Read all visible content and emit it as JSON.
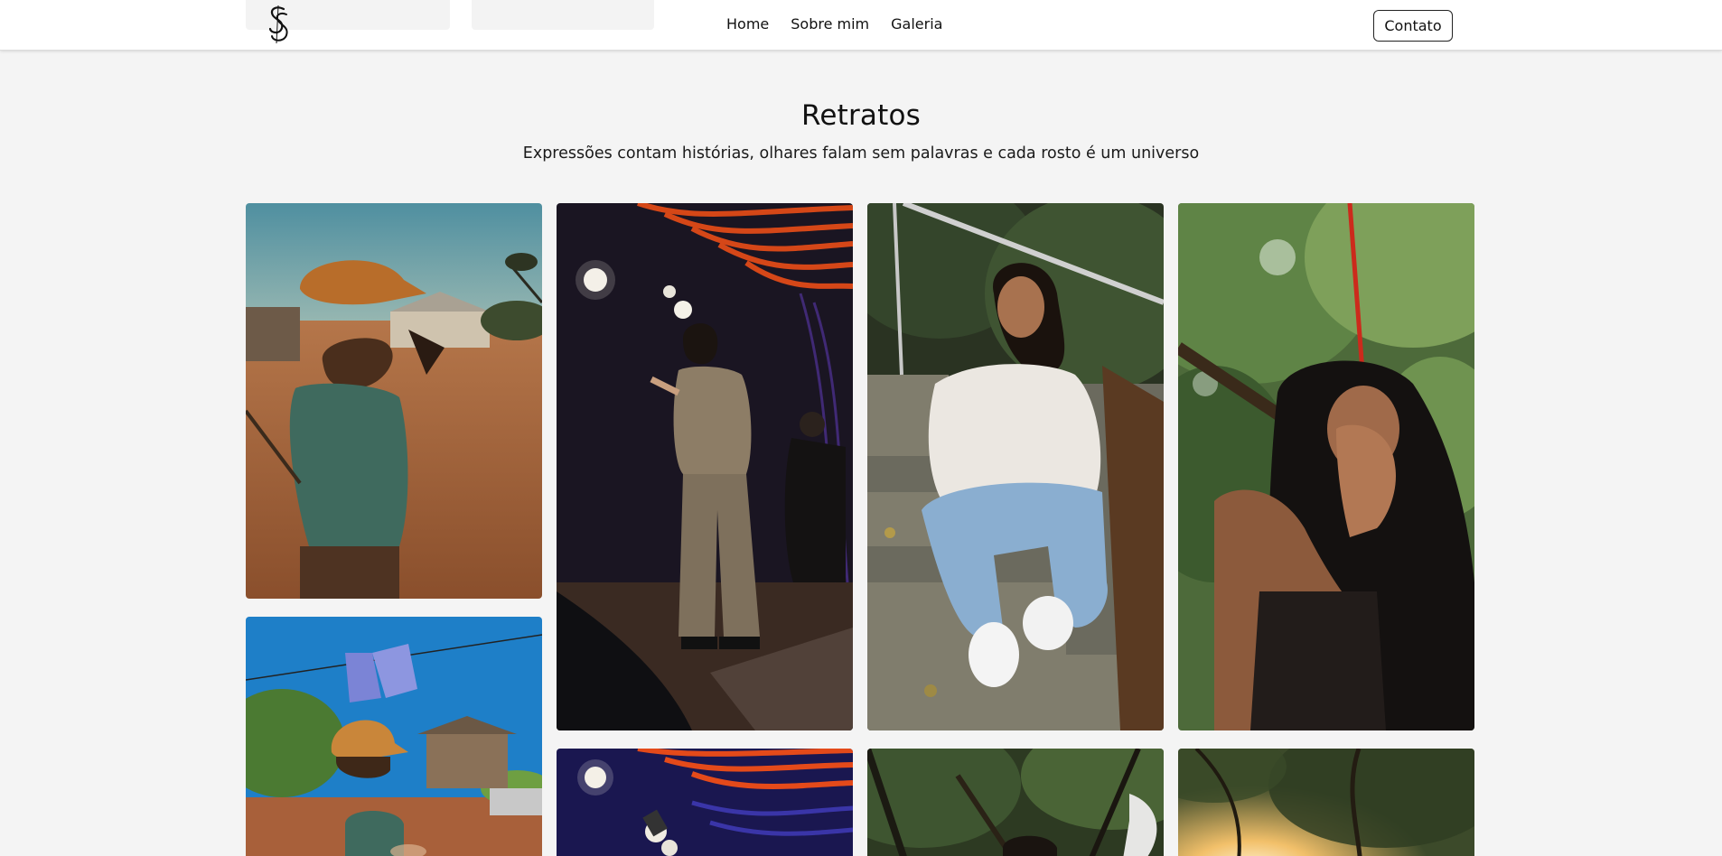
{
  "header": {
    "logo_alt": "SS monogram",
    "nav": [
      {
        "label": "Home"
      },
      {
        "label": "Sobre mim"
      },
      {
        "label": "Galeria"
      }
    ],
    "contact_label": "Contato"
  },
  "section": {
    "title": "Retratos",
    "subtitle": "Expressões contam histórias, olhares falam sem palavras e cada rosto é um universo"
  },
  "gallery": {
    "photos": [
      {
        "subject": "boy in orange cap holding slingshot, dry red earth"
      },
      {
        "subject": "singer on stage with microphone, orange curved lights"
      },
      {
        "subject": "girl sitting on stone steps, white sneakers"
      },
      {
        "subject": "smiling woman under green tree canopy, red rope"
      },
      {
        "subject": "boy in cap under blue sky with hanging clothes"
      },
      {
        "subject": "stage lights, blue and orange"
      },
      {
        "subject": "forest portrait"
      },
      {
        "subject": "sunlight through trees"
      }
    ]
  },
  "colors": {
    "background": "#f4f4f4",
    "header_bg": "#ffffff",
    "text": "#111111"
  }
}
